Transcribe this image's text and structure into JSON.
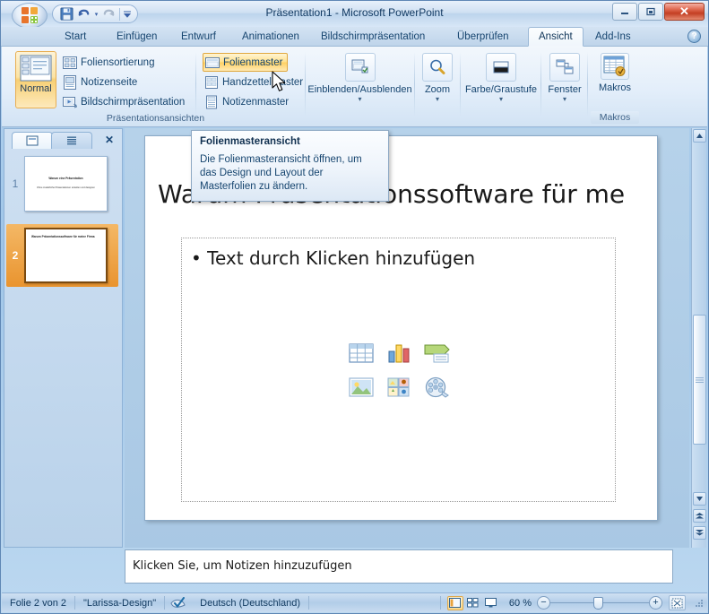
{
  "window": {
    "title": "Präsentation1  -  Microsoft PowerPoint",
    "minimize_label": "—",
    "restore_label": "❐",
    "close_label": "✕"
  },
  "office_button": {
    "name": "office-button",
    "label": "Office"
  },
  "quick_access": {
    "save_label": "Speichern",
    "undo_label": "Rückgängig",
    "undo_dropdown_label": "▾",
    "redo_label": "Wiederholen",
    "customize_label": "Symbolleiste für den Schnellzugriff anpassen"
  },
  "tabs": [
    {
      "label": "Start",
      "active": false
    },
    {
      "label": "Einfügen",
      "active": false
    },
    {
      "label": "Entwurf",
      "active": false
    },
    {
      "label": "Animationen",
      "active": false
    },
    {
      "label": "Bildschirmpräsentation",
      "active": false
    },
    {
      "label": "Überprüfen",
      "active": false
    },
    {
      "label": "Ansicht",
      "active": true
    },
    {
      "label": "Add-Ins",
      "active": false
    }
  ],
  "help_button_label": "?",
  "ribbon": {
    "groups": [
      {
        "name": "praesentationsansichten",
        "label": "Präsentationsansichten",
        "big_button": {
          "label": "Normal",
          "icon": "normal-view-icon",
          "selected": true
        },
        "column1": [
          {
            "label": "Foliensortierung",
            "icon": "slide-sorter-icon",
            "highlighted": false
          },
          {
            "label": "Notizenseite",
            "icon": "notes-page-icon",
            "highlighted": false
          },
          {
            "label": "Bildschirmpräsentation",
            "icon": "slide-show-icon",
            "highlighted": false
          }
        ],
        "column2": [
          {
            "label": "Folienmaster",
            "icon": "slide-master-icon",
            "highlighted": true
          },
          {
            "label": "Handzettelmaster",
            "icon": "handout-master-icon",
            "highlighted": false
          },
          {
            "label": "Notizenmaster",
            "icon": "notes-master-icon",
            "highlighted": false
          }
        ]
      },
      {
        "name": "einblenden-ausblenden",
        "label": "",
        "button": {
          "label": "Einblenden/Ausblenden",
          "icon": "show-hide-icon",
          "arrow": "▾"
        }
      },
      {
        "name": "zoom",
        "label": "",
        "button": {
          "label": "Zoom",
          "icon": "zoom-magnifier-icon",
          "arrow": "▾"
        }
      },
      {
        "name": "farbe-graustufe",
        "label": "",
        "button": {
          "label": "Farbe/Graustufe",
          "icon": "color-grayscale-icon",
          "arrow": "▾"
        }
      },
      {
        "name": "fenster",
        "label": "",
        "button": {
          "label": "Fenster",
          "icon": "window-arrange-icon",
          "arrow": "▾"
        }
      },
      {
        "name": "makros",
        "label": "Makros",
        "button": {
          "label": "Makros",
          "icon": "macros-icon",
          "arrow": ""
        }
      }
    ]
  },
  "tooltip": {
    "title": "Folienmasteransicht",
    "body": "Die Folienmasteransicht öffnen, um das Design und Layout der Masterfolien zu ändern."
  },
  "slide_panel": {
    "tab_slides_label": "Folien",
    "tab_outline_label": "Gliederung",
    "close_label": "✕",
    "slides": [
      {
        "number": "1",
        "selected": false,
        "title": "Warum eine Präsentation",
        "subtitle": "Ohne zusätzliche Präsentationen erstellen und designen"
      },
      {
        "number": "2",
        "selected": true,
        "title": "Warum Präsentationssoftware für meine Firma"
      }
    ]
  },
  "slide": {
    "title": "Warum Präsentationssoftware für me",
    "body_bullet": "• Text durch Klicken hinzufügen",
    "content_icons": [
      {
        "name": "insert-table-icon",
        "label": "Tabelle einfügen"
      },
      {
        "name": "insert-chart-icon",
        "label": "Diagramm einfügen"
      },
      {
        "name": "insert-smartart-icon",
        "label": "SmartArt-Grafik einfügen"
      },
      {
        "name": "insert-picture-icon",
        "label": "Grafik aus Datei einfügen"
      },
      {
        "name": "insert-clipart-icon",
        "label": "ClipArt einfügen"
      },
      {
        "name": "insert-media-icon",
        "label": "Mediaclip einfügen"
      }
    ]
  },
  "notes": {
    "placeholder": "Klicken Sie, um Notizen hinzuzufügen"
  },
  "scrollbar": {
    "up_label": "▲",
    "down_label": "▼",
    "prev_slide_label": "▲",
    "next_slide_label": "▼"
  },
  "status_bar": {
    "slide_counter": "Folie 2 von 2",
    "design_name": "\"Larissa-Design\"",
    "spellcheck_icon": "spellcheck-icon",
    "language": "Deutsch (Deutschland)",
    "view_buttons": [
      {
        "name": "view-normal",
        "active": true
      },
      {
        "name": "view-slide-sorter",
        "active": false
      },
      {
        "name": "view-slideshow",
        "active": false
      }
    ],
    "zoom_level": "60 %",
    "zoom_out_label": "−",
    "zoom_in_label": "+",
    "fit_to_window_label": "An Fenster anpassen"
  },
  "colors": {
    "accent_orange": "#f7cf74",
    "highlight_gold": "#ffd061",
    "chrome_blue": "#9fc5e8",
    "text_blue": "#16456f",
    "close_red": "#c33f23"
  }
}
